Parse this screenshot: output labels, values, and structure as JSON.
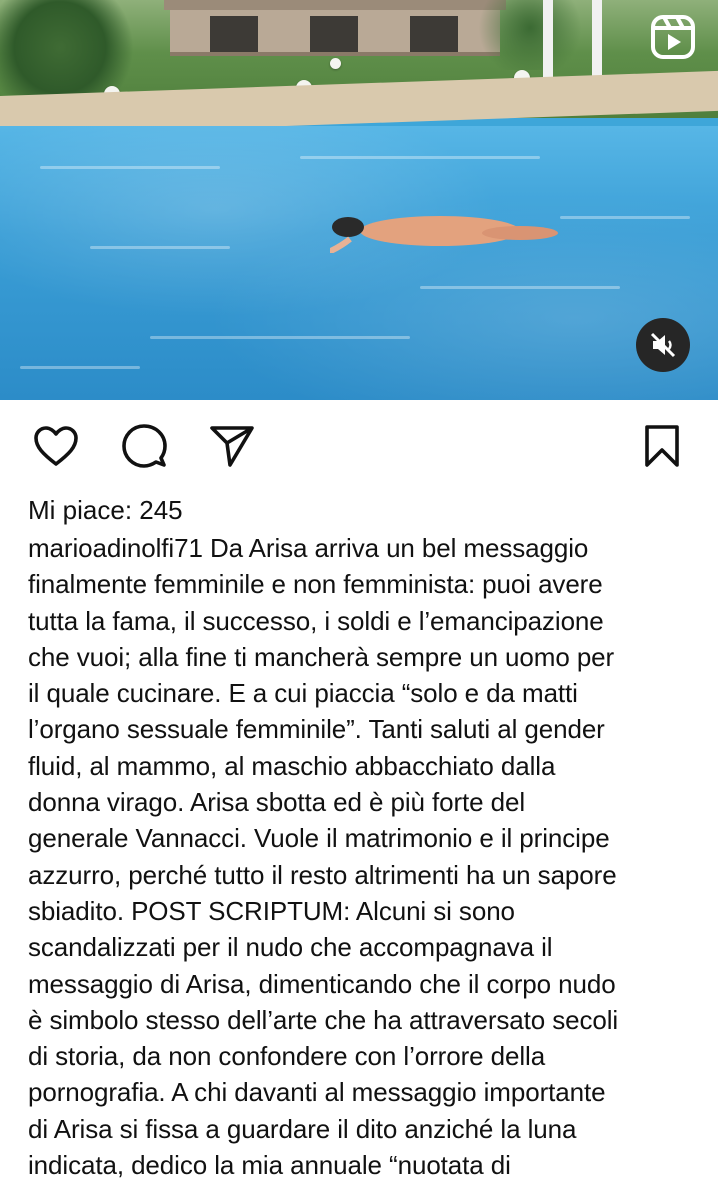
{
  "video": {
    "reels_icon": "reels-icon",
    "mute_icon": "muted-speaker-icon"
  },
  "actions": {
    "like_icon": "heart-icon",
    "comment_icon": "comment-icon",
    "share_icon": "send-icon",
    "save_icon": "bookmark-icon"
  },
  "post": {
    "likes": "Mi piace: 245",
    "username": "marioadinolfi71",
    "lines": [
      " Da Arisa arriva un bel messaggio",
      "finalmente femminile e non femminista: puoi avere",
      "tutta la fama, il successo, i soldi e l’emancipazione",
      "che vuoi; alla fine ti mancherà sempre un uomo per",
      "il quale cucinare. E a cui piaccia “solo e da matti",
      "l’organo sessuale femminile”. Tanti saluti al gender",
      "fluid, al mammo, al maschio abbacchiato dalla",
      "donna virago. Arisa sbotta ed è più forte del",
      "generale Vannacci. Vuole il matrimonio e il principe",
      "azzurro, perché tutto il resto altrimenti ha un sapore",
      "sbiadito. POST SCRIPTUM: Alcuni si sono",
      "scandalizzati per il nudo che accompagnava il",
      "messaggio di Arisa, dimenticando che il corpo nudo",
      "è simbolo stesso dell’arte che ha attraversato secoli",
      "di storia, da non confondere con l’orrore della",
      "pornografia. A chi davanti al messaggio importante",
      "di Arisa si fissa a guardare il dito anziché la luna",
      "indicata, dedico la mia annuale “nuotata di"
    ]
  }
}
